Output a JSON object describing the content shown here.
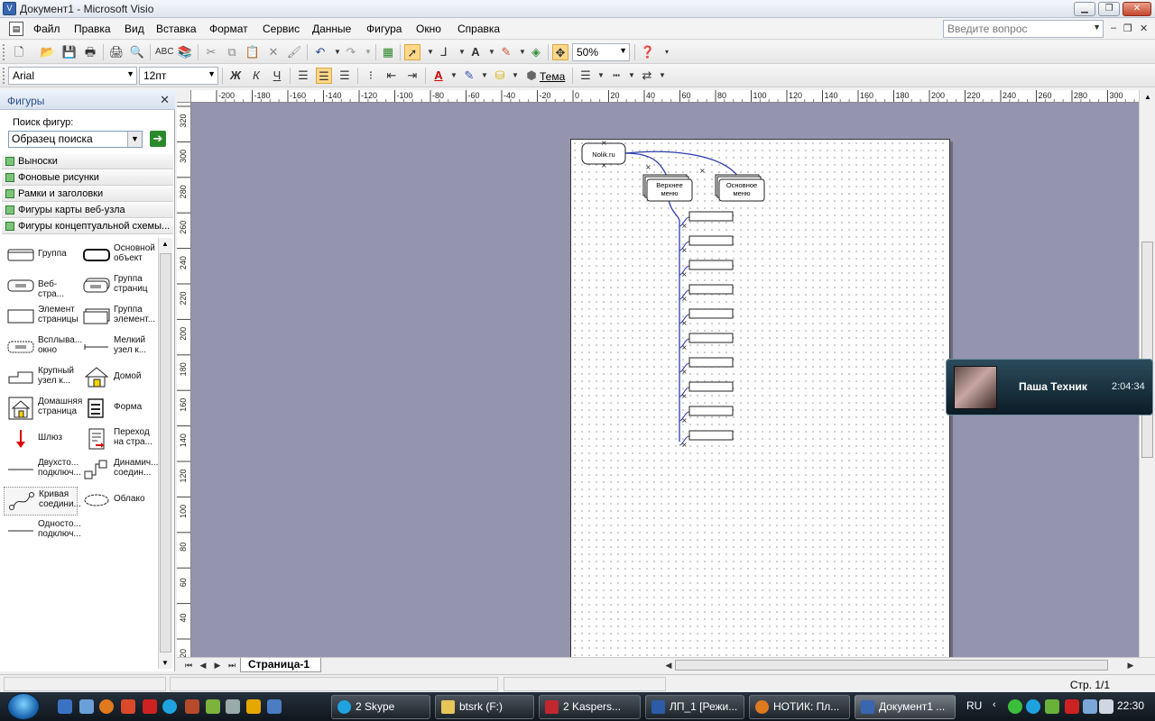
{
  "window": {
    "title": "Документ1 - Microsoft Visio"
  },
  "menu": {
    "items": [
      "Файл",
      "Правка",
      "Вид",
      "Вставка",
      "Формат",
      "Сервис",
      "Данные",
      "Фигура",
      "Окно",
      "Справка"
    ],
    "help_placeholder": "Введите вопрос"
  },
  "toolbar": {
    "zoom": "50%",
    "theme_label": "Тема",
    "font_name": "Arial",
    "font_size": "12пт"
  },
  "shapes_panel": {
    "title": "Фигуры",
    "search_label": "Поиск фигур:",
    "search_value": "Образец поиска",
    "stencils": [
      "Выноски",
      "Фоновые рисунки",
      "Рамки и заголовки",
      "Фигуры карты веб-узла",
      "Фигуры концептуальной схемы..."
    ],
    "shapes": [
      {
        "label": "Группа",
        "icon": "group-shape-icon"
      },
      {
        "label": "Основной объект",
        "icon": "main-object-shape-icon"
      },
      {
        "label": "Веб-стра...",
        "icon": "web-page-shape-icon"
      },
      {
        "label": "Группа страниц",
        "icon": "page-group-shape-icon"
      },
      {
        "label": "Элемент страницы",
        "icon": "page-element-shape-icon"
      },
      {
        "label": "Группа элемент...",
        "icon": "element-group-shape-icon"
      },
      {
        "label": "Всплыва... окно",
        "icon": "popup-window-shape-icon"
      },
      {
        "label": "Мелкий узел к...",
        "icon": "small-node-shape-icon"
      },
      {
        "label": "Крупный узел к...",
        "icon": "large-node-shape-icon"
      },
      {
        "label": "Домой",
        "icon": "home-icon"
      },
      {
        "label": "Домашняя страница",
        "icon": "home-page-icon"
      },
      {
        "label": "Форма",
        "icon": "form-icon"
      },
      {
        "label": "Шлюз",
        "icon": "gateway-arrow-icon"
      },
      {
        "label": "Переход на стра...",
        "icon": "page-jump-icon"
      },
      {
        "label": "Двухсто... подключ...",
        "icon": "two-way-connector-icon"
      },
      {
        "label": "Динамич... соедин...",
        "icon": "dynamic-connector-icon"
      },
      {
        "label": "Кривая соедини...",
        "icon": "curved-connector-icon"
      },
      {
        "label": "Облако",
        "icon": "cloud-icon"
      },
      {
        "label": "Односто... подключ...",
        "icon": "one-way-connector-icon"
      }
    ]
  },
  "ruler": {
    "h_ticks": [
      "-200",
      "-180",
      "-160",
      "-140",
      "-120",
      "-100",
      "-80",
      "-60",
      "-40",
      "-20",
      "0",
      "20",
      "40",
      "60",
      "80",
      "100",
      "120",
      "140",
      "160",
      "180",
      "200",
      "220",
      "240",
      "260",
      "280",
      "300"
    ],
    "v_ticks": [
      "320",
      "300",
      "280",
      "260",
      "240",
      "220",
      "200",
      "180",
      "160",
      "140",
      "120",
      "100",
      "80",
      "60",
      "40",
      "20"
    ]
  },
  "diagram": {
    "root": "Nolik.ru",
    "nodes": [
      {
        "line1": "Верхнее",
        "line2": "меню"
      },
      {
        "line1": "Основное",
        "line2": "меню"
      }
    ],
    "child_count": 10
  },
  "page_tab": "Страница-1",
  "status": {
    "page_info": "Стр. 1/1"
  },
  "notification": {
    "name": "Паша Техник",
    "time": "2:04:34"
  },
  "taskbar": {
    "tasks": [
      "2 Skype",
      "btsrk (F:)",
      "2 Kaspers...",
      "ЛП_1 [Режи...",
      "НОТИК: Пл...",
      "Документ1 ..."
    ],
    "lang": "RU",
    "clock": "22:30"
  }
}
